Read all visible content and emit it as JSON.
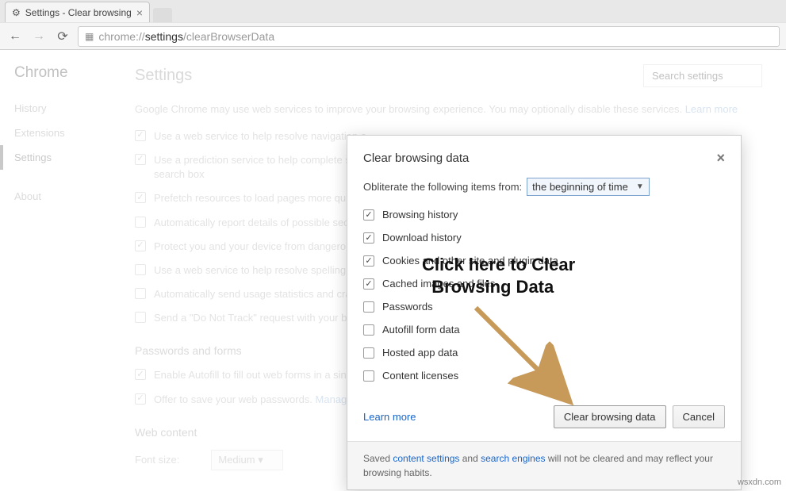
{
  "tab_title": "Settings - Clear browsing",
  "url_prefix": "chrome://",
  "url_strong": "settings",
  "url_suffix": "/clearBrowserData",
  "sidebar": {
    "brand": "Chrome",
    "items": [
      "History",
      "Extensions",
      "Settings"
    ],
    "about": "About"
  },
  "main": {
    "title": "Settings",
    "search_placeholder": "Search settings",
    "intro_a": "Google Chrome may use web services to improve your browsing experience. You may optionally disable these services. ",
    "learn_more": "Learn more",
    "checks": [
      {
        "checked": true,
        "label": "Use a web service to help resolve navigation e"
      },
      {
        "checked": true,
        "label": "Use a prediction service to help complete sear\nsearch box"
      },
      {
        "checked": true,
        "label": "Prefetch resources to load pages more quickl"
      },
      {
        "checked": false,
        "label": "Automatically report details of possible secur"
      },
      {
        "checked": true,
        "label": "Protect you and your device from dangerous"
      },
      {
        "checked": false,
        "label": "Use a web service to help resolve spelling err"
      },
      {
        "checked": false,
        "label": "Automatically send usage statistics and crash"
      },
      {
        "checked": false,
        "label": "Send a \"Do Not Track\" request with your brow"
      }
    ],
    "passwords_h": "Passwords and forms",
    "pw_checks": [
      {
        "checked": true,
        "label": "Enable Autofill to fill out web forms in a singl"
      },
      {
        "checked": true,
        "label": "Offer to save your web passwords. "
      }
    ],
    "manage_pw": "Manage p",
    "webcontent_h": "Web content",
    "font_label": "Font size:",
    "font_value": "Medium"
  },
  "dialog": {
    "title": "Clear browsing data",
    "obliterate": "Obliterate the following items from:",
    "time_value": "the beginning of time",
    "items": [
      {
        "checked": true,
        "label": "Browsing history"
      },
      {
        "checked": true,
        "label": "Download history"
      },
      {
        "checked": true,
        "label": "Cookies and other site and plugin data"
      },
      {
        "checked": true,
        "label": "Cached images and files"
      },
      {
        "checked": false,
        "label": "Passwords"
      },
      {
        "checked": false,
        "label": "Autofill form data"
      },
      {
        "checked": false,
        "label": "Hosted app data"
      },
      {
        "checked": false,
        "label": "Content licenses"
      }
    ],
    "learn_more": "Learn more",
    "btn_clear": "Clear browsing data",
    "btn_cancel": "Cancel",
    "footer_a": "Saved ",
    "footer_link1": "content settings",
    "footer_b": " and ",
    "footer_link2": "search engines",
    "footer_c": " will not be cleared and may reflect your browsing habits."
  },
  "annotation": "Click here to Clear\n  Browsing Data",
  "watermark": "wsxdn.com"
}
